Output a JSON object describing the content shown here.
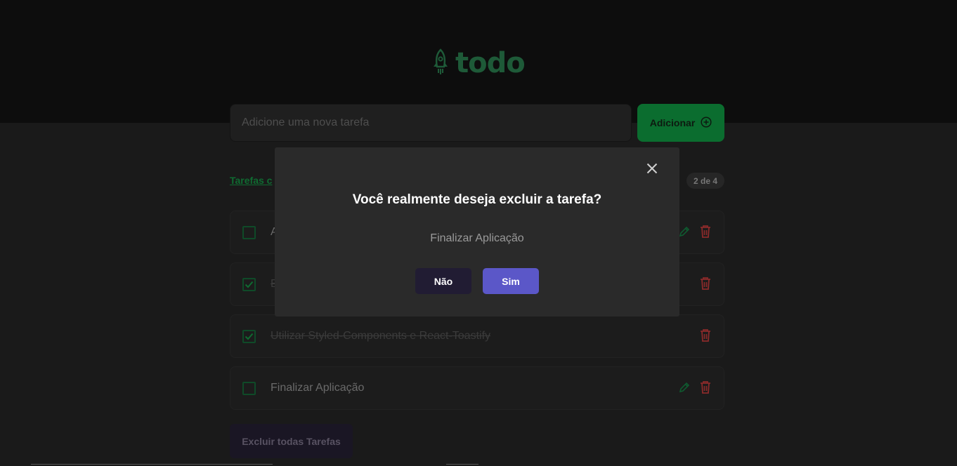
{
  "app": {
    "logo_text": "todo",
    "logo_icon": "rocket-icon"
  },
  "new_task": {
    "placeholder": "Adicione uma nova tarefa",
    "value": "",
    "add_label": "Adicionar",
    "add_icon": "plus-circle-icon"
  },
  "tabs": {
    "label": "Tarefas c",
    "count_badge": "2 de 4"
  },
  "tasks": [
    {
      "text": "A",
      "done": false,
      "has_edit": true
    },
    {
      "text": "E",
      "done": true,
      "has_edit": false
    },
    {
      "text": "Utilizar Styled-Components e React-Toastify",
      "done": true,
      "has_edit": false
    },
    {
      "text": "Finalizar Aplicação",
      "done": false,
      "has_edit": true
    }
  ],
  "clear_all_label": "Excluir todas Tarefas",
  "modal": {
    "title": "Você realmente deseja excluir a tarefa?",
    "task_name": "Finalizar Aplicação",
    "no_label": "Não",
    "yes_label": "Sim",
    "close_icon": "close-icon"
  },
  "colors": {
    "accent_green": "#0b6d2f",
    "danger_red": "#9a2b2b",
    "confirm_purple": "#5b57c8"
  }
}
